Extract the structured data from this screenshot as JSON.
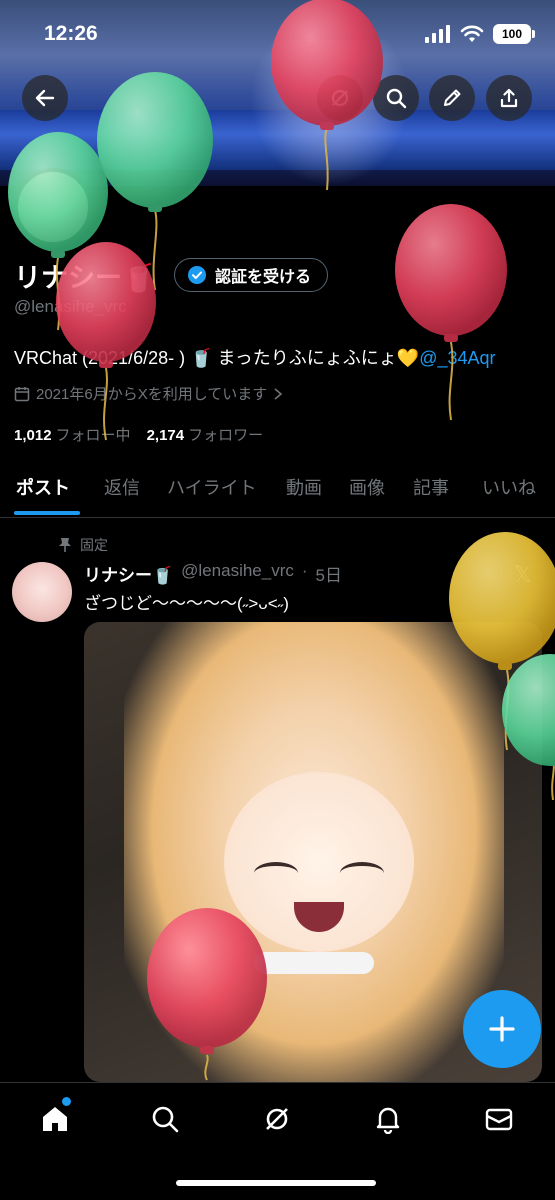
{
  "status_bar": {
    "time": "12:26",
    "battery": "100"
  },
  "header": {
    "back_icon": "arrow-left-icon",
    "actions": [
      "search-icon",
      "edit-icon",
      "share-icon"
    ]
  },
  "profile": {
    "name": "リナシー🥤",
    "verify_label": "認証を受ける",
    "handle": "@lenasihe_vrc",
    "bio_text": "VRChat (2021/6/28- ) 🥤 まったりふにょふにょ💛",
    "bio_mention": "@_34Aqr",
    "joined": "2021年6月からXを利用しています",
    "following_count": "1,012",
    "following_label": "フォロー中",
    "followers_count": "2,174",
    "followers_label": "フォロワー"
  },
  "tabs": [
    "ポスト",
    "返信",
    "ハイライト",
    "動画",
    "画像",
    "記事",
    "いいね"
  ],
  "active_tab": "ポスト",
  "pinned_post": {
    "pinned_label": "固定",
    "author": "リナシー🥤",
    "handle": "@lenasihe_vrc",
    "time": "5日",
    "text": "ざつじど〜〜〜〜〜(˶>ᴗ<˶)"
  },
  "nav": [
    "home-icon",
    "search-icon",
    "grok-icon",
    "notifications-icon",
    "messages-icon"
  ],
  "colors": {
    "accent": "#1d9bf0",
    "balloon_red": "#e8435e",
    "balloon_green": "#5ad69a",
    "balloon_yellow": "#f0c83a"
  }
}
